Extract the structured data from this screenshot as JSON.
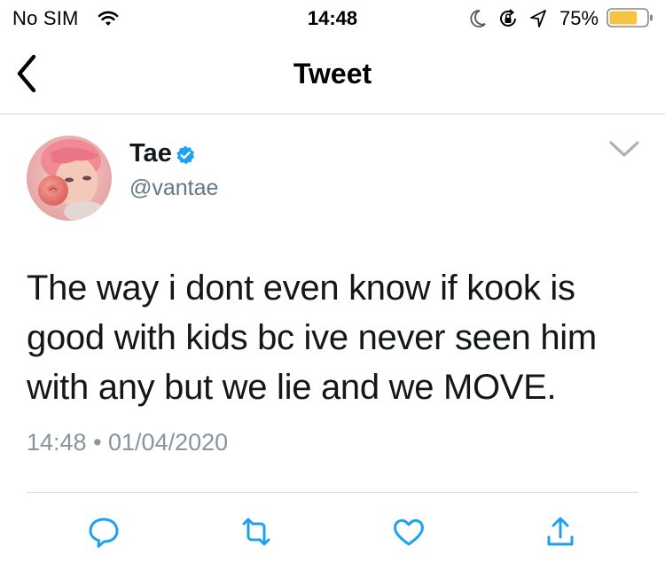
{
  "status_bar": {
    "carrier": "No SIM",
    "time": "14:48",
    "battery_percent": "75%",
    "battery_level": 0.75,
    "battery_color": "#f6c443",
    "icons": [
      "wifi-icon",
      "moon-icon",
      "lock-rotation-icon",
      "location-icon",
      "battery-icon"
    ]
  },
  "nav": {
    "title": "Tweet",
    "back_icon": "chevron-left-icon"
  },
  "tweet": {
    "author_name": "Tae",
    "verified": true,
    "verified_color": "#1da1f2",
    "handle": "@vantae",
    "text": "The way i dont even know if kook is good with kids bc ive never seen him with any but we lie and we MOVE.",
    "meta": "14:48 • 01/04/2020",
    "more_icon": "chevron-down-icon"
  },
  "actions": [
    {
      "name": "reply",
      "icon": "reply-icon"
    },
    {
      "name": "retweet",
      "icon": "retweet-icon"
    },
    {
      "name": "like",
      "icon": "heart-icon"
    },
    {
      "name": "share",
      "icon": "share-icon"
    }
  ],
  "colors": {
    "action_icon": "#1da1f2",
    "secondary_text": "#657786",
    "divider": "#d6d6da"
  }
}
